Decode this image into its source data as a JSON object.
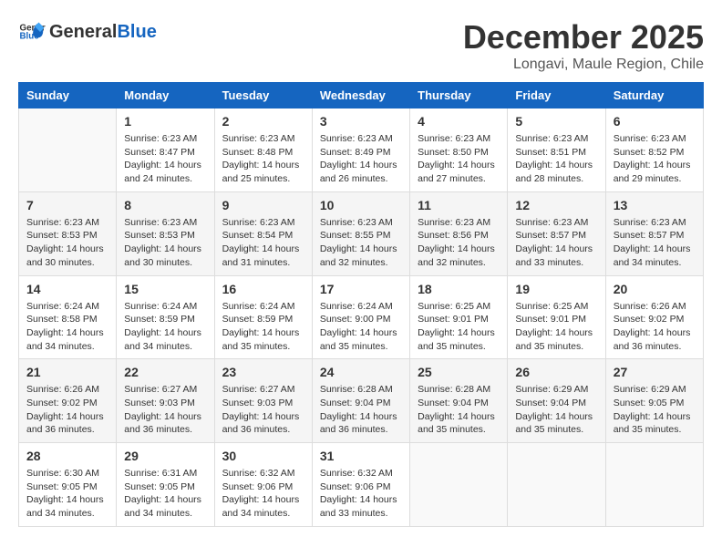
{
  "header": {
    "logo_general": "General",
    "logo_blue": "Blue",
    "month_title": "December 2025",
    "location": "Longavi, Maule Region, Chile"
  },
  "days_of_week": [
    "Sunday",
    "Monday",
    "Tuesday",
    "Wednesday",
    "Thursday",
    "Friday",
    "Saturday"
  ],
  "weeks": [
    [
      {
        "day": "",
        "empty": true
      },
      {
        "day": "1",
        "sunrise": "6:23 AM",
        "sunset": "8:47 PM",
        "daylight": "14 hours and 24 minutes."
      },
      {
        "day": "2",
        "sunrise": "6:23 AM",
        "sunset": "8:48 PM",
        "daylight": "14 hours and 25 minutes."
      },
      {
        "day": "3",
        "sunrise": "6:23 AM",
        "sunset": "8:49 PM",
        "daylight": "14 hours and 26 minutes."
      },
      {
        "day": "4",
        "sunrise": "6:23 AM",
        "sunset": "8:50 PM",
        "daylight": "14 hours and 27 minutes."
      },
      {
        "day": "5",
        "sunrise": "6:23 AM",
        "sunset": "8:51 PM",
        "daylight": "14 hours and 28 minutes."
      },
      {
        "day": "6",
        "sunrise": "6:23 AM",
        "sunset": "8:52 PM",
        "daylight": "14 hours and 29 minutes."
      }
    ],
    [
      {
        "day": "7",
        "sunrise": "6:23 AM",
        "sunset": "8:53 PM",
        "daylight": "14 hours and 30 minutes."
      },
      {
        "day": "8",
        "sunrise": "6:23 AM",
        "sunset": "8:53 PM",
        "daylight": "14 hours and 30 minutes."
      },
      {
        "day": "9",
        "sunrise": "6:23 AM",
        "sunset": "8:54 PM",
        "daylight": "14 hours and 31 minutes."
      },
      {
        "day": "10",
        "sunrise": "6:23 AM",
        "sunset": "8:55 PM",
        "daylight": "14 hours and 32 minutes."
      },
      {
        "day": "11",
        "sunrise": "6:23 AM",
        "sunset": "8:56 PM",
        "daylight": "14 hours and 32 minutes."
      },
      {
        "day": "12",
        "sunrise": "6:23 AM",
        "sunset": "8:57 PM",
        "daylight": "14 hours and 33 minutes."
      },
      {
        "day": "13",
        "sunrise": "6:23 AM",
        "sunset": "8:57 PM",
        "daylight": "14 hours and 34 minutes."
      }
    ],
    [
      {
        "day": "14",
        "sunrise": "6:24 AM",
        "sunset": "8:58 PM",
        "daylight": "14 hours and 34 minutes."
      },
      {
        "day": "15",
        "sunrise": "6:24 AM",
        "sunset": "8:59 PM",
        "daylight": "14 hours and 34 minutes."
      },
      {
        "day": "16",
        "sunrise": "6:24 AM",
        "sunset": "8:59 PM",
        "daylight": "14 hours and 35 minutes."
      },
      {
        "day": "17",
        "sunrise": "6:24 AM",
        "sunset": "9:00 PM",
        "daylight": "14 hours and 35 minutes."
      },
      {
        "day": "18",
        "sunrise": "6:25 AM",
        "sunset": "9:01 PM",
        "daylight": "14 hours and 35 minutes."
      },
      {
        "day": "19",
        "sunrise": "6:25 AM",
        "sunset": "9:01 PM",
        "daylight": "14 hours and 35 minutes."
      },
      {
        "day": "20",
        "sunrise": "6:26 AM",
        "sunset": "9:02 PM",
        "daylight": "14 hours and 36 minutes."
      }
    ],
    [
      {
        "day": "21",
        "sunrise": "6:26 AM",
        "sunset": "9:02 PM",
        "daylight": "14 hours and 36 minutes."
      },
      {
        "day": "22",
        "sunrise": "6:27 AM",
        "sunset": "9:03 PM",
        "daylight": "14 hours and 36 minutes."
      },
      {
        "day": "23",
        "sunrise": "6:27 AM",
        "sunset": "9:03 PM",
        "daylight": "14 hours and 36 minutes."
      },
      {
        "day": "24",
        "sunrise": "6:28 AM",
        "sunset": "9:04 PM",
        "daylight": "14 hours and 36 minutes."
      },
      {
        "day": "25",
        "sunrise": "6:28 AM",
        "sunset": "9:04 PM",
        "daylight": "14 hours and 35 minutes."
      },
      {
        "day": "26",
        "sunrise": "6:29 AM",
        "sunset": "9:04 PM",
        "daylight": "14 hours and 35 minutes."
      },
      {
        "day": "27",
        "sunrise": "6:29 AM",
        "sunset": "9:05 PM",
        "daylight": "14 hours and 35 minutes."
      }
    ],
    [
      {
        "day": "28",
        "sunrise": "6:30 AM",
        "sunset": "9:05 PM",
        "daylight": "14 hours and 34 minutes."
      },
      {
        "day": "29",
        "sunrise": "6:31 AM",
        "sunset": "9:05 PM",
        "daylight": "14 hours and 34 minutes."
      },
      {
        "day": "30",
        "sunrise": "6:32 AM",
        "sunset": "9:06 PM",
        "daylight": "14 hours and 34 minutes."
      },
      {
        "day": "31",
        "sunrise": "6:32 AM",
        "sunset": "9:06 PM",
        "daylight": "14 hours and 33 minutes."
      },
      {
        "day": "",
        "empty": true
      },
      {
        "day": "",
        "empty": true
      },
      {
        "day": "",
        "empty": true
      }
    ]
  ],
  "labels": {
    "sunrise": "Sunrise:",
    "sunset": "Sunset:",
    "daylight": "Daylight:"
  }
}
